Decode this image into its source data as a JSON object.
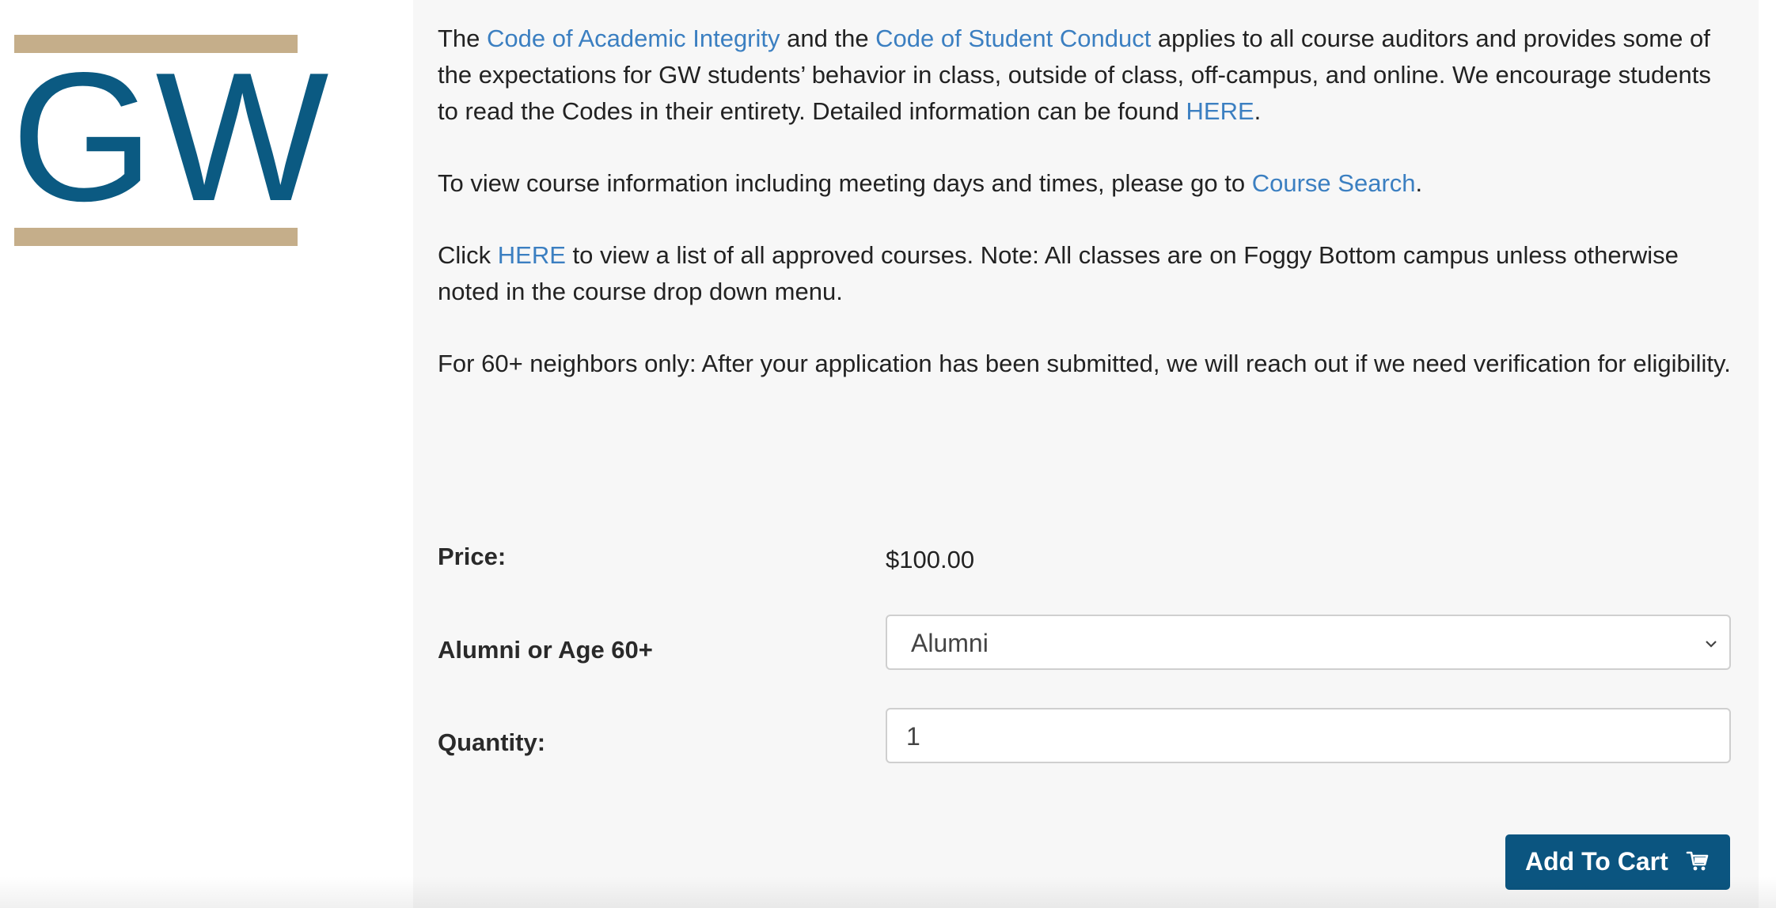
{
  "logo": {
    "text": "GW",
    "colors": {
      "bar": "#c5ae8a",
      "letters": "#0b5a82"
    }
  },
  "intro": {
    "p1": {
      "t1": "The ",
      "link1": "Code of Academic Integrity",
      "t2": " and the ",
      "link2": "Code of Student Conduct",
      "t3": " applies to all course auditors and provides some of the expectations for GW students’ behavior in class, outside of class, off-campus, and online. We encourage students to read the Codes in their entirety.  Detailed information can be found ",
      "link3": "HERE",
      "t4": "."
    },
    "p2": {
      "t1": "To view course information including meeting days and times, please go to ",
      "link1": "Course Search",
      "t2": "."
    },
    "p3": {
      "t1": "Click ",
      "link1": "HERE",
      "t2": " to view a list of all approved courses.  Note: All classes are on Foggy Bottom campus unless otherwise noted in the course drop down menu."
    },
    "p4": {
      "t1": "For 60+ neighbors only:  After your application has been submitted, we will reach out if we need verification for eligibility."
    }
  },
  "form": {
    "price_label": "Price:",
    "price_value": "$100.00",
    "category_label": "Alumni or Age 60+",
    "category_selected": "Alumni",
    "quantity_label": "Quantity:",
    "quantity_value": "1"
  },
  "cart_button": {
    "label": "Add To Cart",
    "icon": "cart-icon"
  },
  "colors": {
    "link": "#3b7fc1",
    "button": "#0b5580",
    "panel": "#f7f7f7"
  }
}
